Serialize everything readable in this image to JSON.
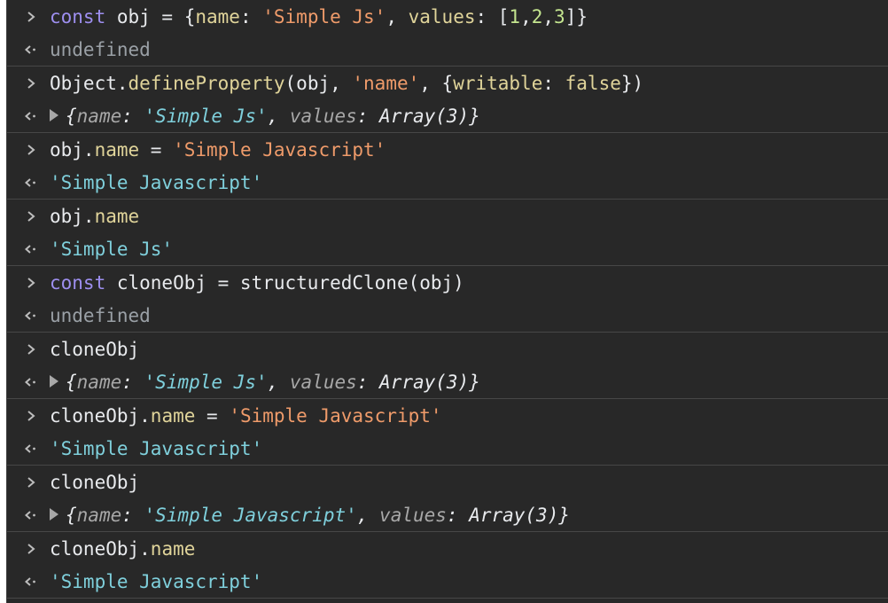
{
  "colors": {
    "background": "#282828",
    "keyword": "#9e8ff0",
    "string": "#ef9b6a",
    "number": "#c4e58f",
    "property": "#e0d49a",
    "result_string": "#7fd0dc",
    "undefined": "#9aa0a6"
  },
  "icons": {
    "prompt": "chevron-right-icon",
    "result": "return-arrow-icon",
    "expand": "triangle-right-icon"
  },
  "entries": [
    {
      "input": [
        {
          "t": "kw",
          "v": "const"
        },
        {
          "t": "plain",
          "v": " obj = {"
        },
        {
          "t": "fn",
          "v": "name"
        },
        {
          "t": "plain",
          "v": ": "
        },
        {
          "t": "str",
          "v": "'Simple Js'"
        },
        {
          "t": "plain",
          "v": ", "
        },
        {
          "t": "fn",
          "v": "values"
        },
        {
          "t": "plain",
          "v": ": ["
        },
        {
          "t": "num",
          "v": "1"
        },
        {
          "t": "plain",
          "v": ","
        },
        {
          "t": "num",
          "v": "2"
        },
        {
          "t": "plain",
          "v": ","
        },
        {
          "t": "num",
          "v": "3"
        },
        {
          "t": "plain",
          "v": "]}"
        }
      ],
      "output": {
        "kind": "undefined",
        "tokens": [
          {
            "t": "undef",
            "v": "undefined"
          }
        ]
      }
    },
    {
      "input": [
        {
          "t": "plain",
          "v": "Object."
        },
        {
          "t": "fn",
          "v": "defineProperty"
        },
        {
          "t": "plain",
          "v": "(obj, "
        },
        {
          "t": "str",
          "v": "'name'"
        },
        {
          "t": "plain",
          "v": ", {"
        },
        {
          "t": "fn",
          "v": "writable"
        },
        {
          "t": "plain",
          "v": ": "
        },
        {
          "t": "fn",
          "v": "false"
        },
        {
          "t": "plain",
          "v": "})"
        }
      ],
      "output": {
        "kind": "object",
        "tokens": [
          {
            "t": "oval",
            "v": "{"
          },
          {
            "t": "okey",
            "v": "name"
          },
          {
            "t": "oval",
            "v": ": "
          },
          {
            "t": "ostr",
            "v": "'Simple Js'"
          },
          {
            "t": "oval",
            "v": ", "
          },
          {
            "t": "okey",
            "v": "values"
          },
          {
            "t": "oval",
            "v": ": Array(3)}"
          }
        ]
      }
    },
    {
      "input": [
        {
          "t": "plain",
          "v": "obj."
        },
        {
          "t": "prop",
          "v": "name"
        },
        {
          "t": "plain",
          "v": " = "
        },
        {
          "t": "str",
          "v": "'Simple Javascript'"
        }
      ],
      "output": {
        "kind": "string",
        "tokens": [
          {
            "t": "rstr",
            "v": "'Simple Javascript'"
          }
        ]
      }
    },
    {
      "input": [
        {
          "t": "plain",
          "v": "obj."
        },
        {
          "t": "prop",
          "v": "name"
        }
      ],
      "output": {
        "kind": "string",
        "tokens": [
          {
            "t": "rstr",
            "v": "'Simple Js'"
          }
        ]
      }
    },
    {
      "input": [
        {
          "t": "kw",
          "v": "const"
        },
        {
          "t": "plain",
          "v": " cloneObj = structuredClone(obj)"
        }
      ],
      "output": {
        "kind": "undefined",
        "tokens": [
          {
            "t": "undef",
            "v": "undefined"
          }
        ]
      }
    },
    {
      "input": [
        {
          "t": "plain",
          "v": "cloneObj"
        }
      ],
      "output": {
        "kind": "object",
        "tokens": [
          {
            "t": "oval",
            "v": "{"
          },
          {
            "t": "okey",
            "v": "name"
          },
          {
            "t": "oval",
            "v": ": "
          },
          {
            "t": "ostr",
            "v": "'Simple Js'"
          },
          {
            "t": "oval",
            "v": ", "
          },
          {
            "t": "okey",
            "v": "values"
          },
          {
            "t": "oval",
            "v": ": Array(3)}"
          }
        ]
      }
    },
    {
      "input": [
        {
          "t": "plain",
          "v": "cloneObj."
        },
        {
          "t": "prop",
          "v": "name"
        },
        {
          "t": "plain",
          "v": " = "
        },
        {
          "t": "str",
          "v": "'Simple Javascript'"
        }
      ],
      "output": {
        "kind": "string",
        "tokens": [
          {
            "t": "rstr",
            "v": "'Simple Javascript'"
          }
        ]
      }
    },
    {
      "input": [
        {
          "t": "plain",
          "v": "cloneObj"
        }
      ],
      "output": {
        "kind": "object",
        "tokens": [
          {
            "t": "oval",
            "v": "{"
          },
          {
            "t": "okey",
            "v": "name"
          },
          {
            "t": "oval",
            "v": ": "
          },
          {
            "t": "ostr",
            "v": "'Simple Javascript'"
          },
          {
            "t": "oval",
            "v": ", "
          },
          {
            "t": "okey",
            "v": "values"
          },
          {
            "t": "oval",
            "v": ": Array(3)}"
          }
        ]
      }
    },
    {
      "input": [
        {
          "t": "plain",
          "v": "cloneObj."
        },
        {
          "t": "prop",
          "v": "name"
        }
      ],
      "output": {
        "kind": "string",
        "tokens": [
          {
            "t": "rstr",
            "v": "'Simple Javascript'"
          }
        ]
      }
    }
  ]
}
